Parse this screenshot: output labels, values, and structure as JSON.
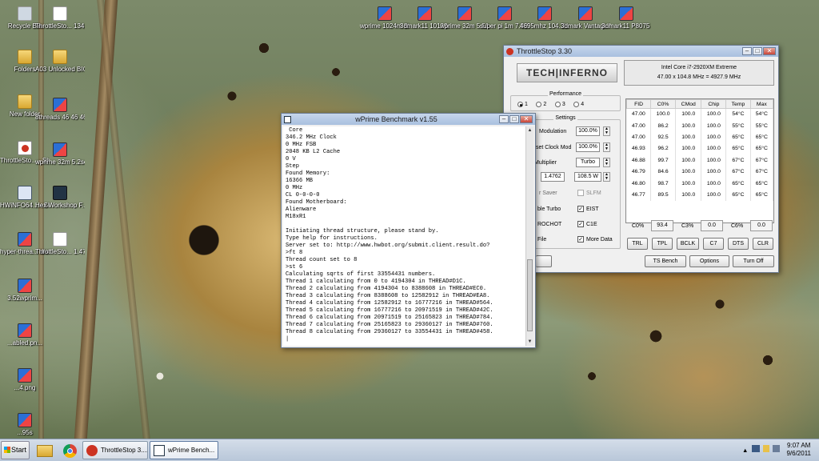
{
  "desktop": {
    "icons": [
      {
        "label": "Recycle Bin"
      },
      {
        "label": "ThrottleSto... 134.4 watt..."
      },
      {
        "label": "Folders"
      },
      {
        "label": "A03 Unlocked BIOS and r..."
      },
      {
        "label": "New folder"
      },
      {
        "label": "8threads 46 46 46 46 1..."
      },
      {
        "label": "ThrottleSto... - Shortcut"
      },
      {
        "label": "wprime 32m 5.2seconds..."
      },
      {
        "label": "HWiNFO64... - Shortcut"
      },
      {
        "label": "Hex Workshop F..."
      },
      {
        "label": "hyper-threa... disabled.png..."
      },
      {
        "label": "ThrottleSto... 1.4762vid..."
      },
      {
        "label": "3.52wprim..."
      },
      {
        "label": "...abled.pn..."
      },
      {
        "label": "...4.png"
      },
      {
        "label": "...95s"
      },
      {
        "label": "wprime 1024m 8thr..."
      },
      {
        "label": "3dmark11 10123cpu..."
      },
      {
        "label": "wprime 32m 5.516secs 1..."
      },
      {
        "label": "super pi 1m 7.825 secs ..."
      },
      {
        "label": "4695mhz 104.3bclk ..."
      },
      {
        "label": "3dmark Vantage P2..."
      },
      {
        "label": "3dmark11 P8075 845..."
      }
    ]
  },
  "wprime": {
    "title": "wPrime Benchmark v1.55",
    "lines": [
      " Core",
      "346.2 MHz Clock",
      "0 MHz FSB",
      "2048 KB L2 Cache",
      "0 V",
      "Step",
      "Found Memory:",
      "16366 MB",
      "0 MHz",
      "CL 0-0-0-0",
      "Found Motherboard:",
      "Alienware",
      "M18xR1",
      "",
      "Initiating thread structure, please stand by.",
      "Type help for instructions.",
      "Server set to: http://www.hwbot.org/submit.client.result.do?",
      ">ft 8",
      "Thread count set to 8",
      ">st 6",
      "Calculating sqrts of first 33554431 numbers.",
      "Thread 1 calculating from 0 to 4194304 in THREAD#D1C.",
      "Thread 2 calculating from 4194304 to 8388608 in THREAD#EC0.",
      "Thread 3 calculating from 8388608 to 12582912 in THREAD#EA8.",
      "Thread 4 calculating from 12582912 to 16777216 in THREAD#564.",
      "Thread 5 calculating from 16777216 to 20971519 in THREAD#42C.",
      "Thread 6 calculating from 20971519 to 25165823 in THREAD#784.",
      "Thread 7 calculating from 25165823 to 29360127 in THREAD#760.",
      "Thread 8 calculating from 29360127 to 33554431 in THREAD#458.",
      "|"
    ]
  },
  "throttlestop": {
    "title": "ThrottleStop 3.30",
    "logo": "TECH|INFERNO",
    "cpu_name": "Intel Core i7-2920XM Extreme",
    "cpu_clock": "47.00 x 104.8 MHz = 4927.9 MHz",
    "performance": {
      "title": "Performance",
      "options": [
        "1",
        "2",
        "3",
        "4"
      ],
      "selected": "1"
    },
    "settings": {
      "title": "Settings",
      "modulation_label": "Modulation",
      "modulation_value": "100.0%",
      "setclock_label": "set Clock Mod",
      "setclock_value": "100.0%",
      "multiplier_label": "Multiplier",
      "multiplier_value": "Turbo",
      "vid_value": "1.4762",
      "power_value": "108.5 W",
      "powersaver_label": "r Saver",
      "slfm_label": "SLFM",
      "turbo_label": "ble Turbo",
      "eist_label": "EIST",
      "prochot_label": "ROCHOT",
      "c1e_label": "C1E",
      "file_label": "File",
      "moredata_label": "More Data"
    },
    "table": {
      "headers": [
        "FID",
        "C0%",
        "CMod",
        "Chip",
        "Temp",
        "Max"
      ],
      "rows": [
        [
          "47.00",
          "100.0",
          "100.0",
          "100.0",
          "54°C",
          "54°C"
        ],
        [
          "47.00",
          "86.2",
          "100.0",
          "100.0",
          "55°C",
          "55°C"
        ],
        [
          "47.00",
          "92.5",
          "100.0",
          "100.0",
          "65°C",
          "65°C"
        ],
        [
          "46.93",
          "96.2",
          "100.0",
          "100.0",
          "65°C",
          "65°C"
        ],
        [
          "46.88",
          "99.7",
          "100.0",
          "100.0",
          "67°C",
          "67°C"
        ],
        [
          "46.79",
          "84.6",
          "100.0",
          "100.0",
          "67°C",
          "67°C"
        ],
        [
          "46.80",
          "98.7",
          "100.0",
          "100.0",
          "65°C",
          "65°C"
        ],
        [
          "46.77",
          "89.5",
          "100.0",
          "100.0",
          "65°C",
          "65°C"
        ]
      ]
    },
    "cstates": {
      "c0_label": "C0%",
      "c0_value": "93.4",
      "c3_label": "C3%",
      "c3_value": "0.0",
      "c6_label": "C6%",
      "c6_value": "0.0"
    },
    "buttons": {
      "trl": "TRL",
      "tpl": "TPL",
      "bclk": "BCLK",
      "c7": "C7",
      "dts": "DTS",
      "clr": "CLR",
      "tsbench": "TS Bench",
      "options": "Options",
      "turnoff": "Turn Off"
    }
  },
  "taskbar": {
    "start": "Start",
    "tasks": [
      "ThrottleStop 3....",
      "wPrime Bench..."
    ],
    "time": "9:07 AM",
    "date": "9/6/2011",
    "tray_arrow": "▲"
  }
}
